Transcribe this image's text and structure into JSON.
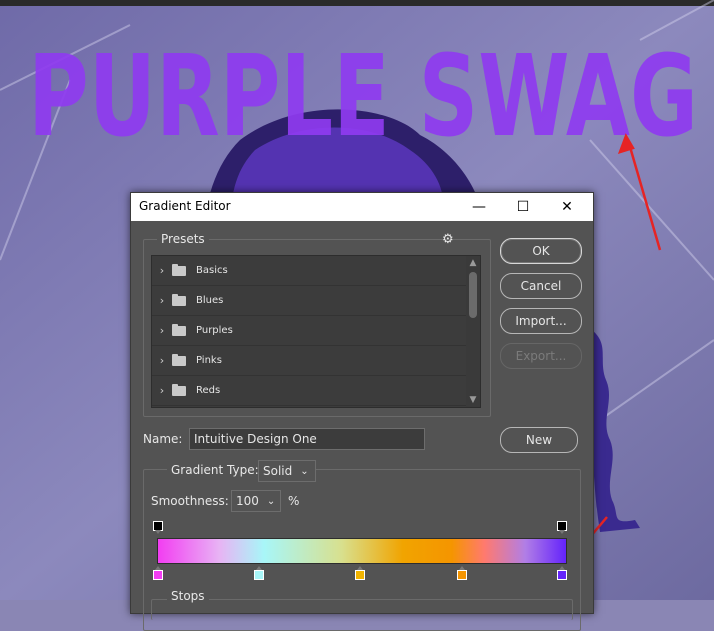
{
  "background": {
    "poster_text": "PURPLE SWAG",
    "colors": {
      "poster_purple": "#8f3bf0",
      "annotation_red": "#e62424"
    }
  },
  "dialog": {
    "title": "Gradient Editor",
    "window_controls": {
      "minimize": "—",
      "maximize": "☐",
      "close": "✕"
    },
    "presets": {
      "label": "Presets",
      "gear_icon": "⚙",
      "items": [
        {
          "label": "Basics"
        },
        {
          "label": "Blues"
        },
        {
          "label": "Purples"
        },
        {
          "label": "Pinks"
        },
        {
          "label": "Reds"
        }
      ]
    },
    "buttons": {
      "ok": "OK",
      "cancel": "Cancel",
      "import": "Import...",
      "export": "Export...",
      "new": "New"
    },
    "name": {
      "label": "Name:",
      "value": "Intuitive Design One"
    },
    "gradient_type": {
      "label": "Gradient Type:",
      "value": "Solid"
    },
    "smoothness": {
      "label": "Smoothness:",
      "value": "100",
      "unit": "%"
    },
    "stops": {
      "label": "Stops"
    },
    "color_stops": [
      "#f23df2",
      "#a8f6f8",
      "#f2b400",
      "#f59500",
      "#6423fb"
    ]
  }
}
